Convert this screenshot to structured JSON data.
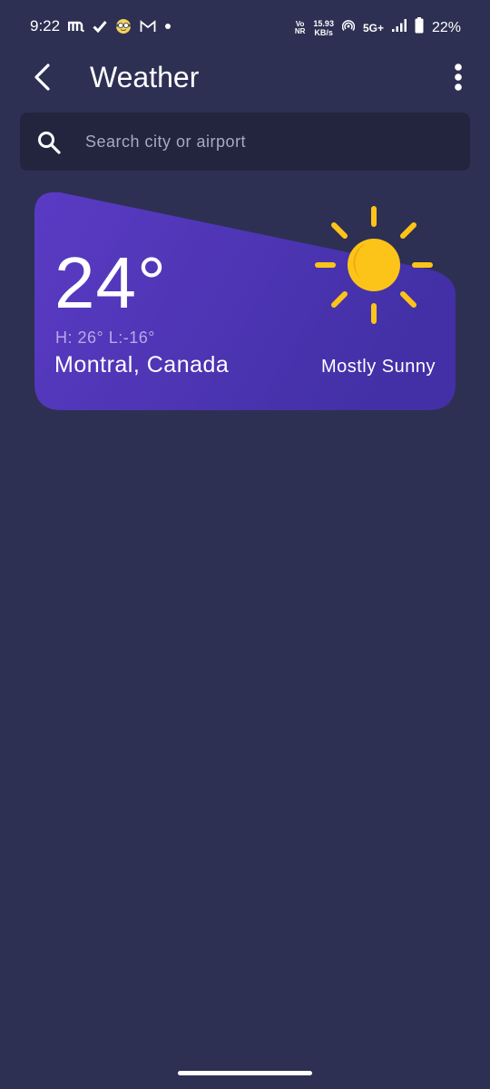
{
  "status_bar": {
    "time": "9:22",
    "volte_top": "Vo",
    "volte_bottom": "NR",
    "netspeed_value": "15.93",
    "netspeed_unit": "KB/s",
    "network": "5G+",
    "battery": "22%"
  },
  "app_bar": {
    "title": "Weather"
  },
  "search": {
    "placeholder": "Search city or airport",
    "value": ""
  },
  "weather_card": {
    "temperature": "24°",
    "hilo": "H: 26°  L:-16°",
    "city": "Montral, Canada",
    "condition": "Mostly Sunny",
    "icon": "sun-icon",
    "colors": {
      "card_start": "#5a3bc4",
      "card_end": "#4330a6",
      "sun": "#fcc419",
      "background": "#2d3053"
    }
  }
}
